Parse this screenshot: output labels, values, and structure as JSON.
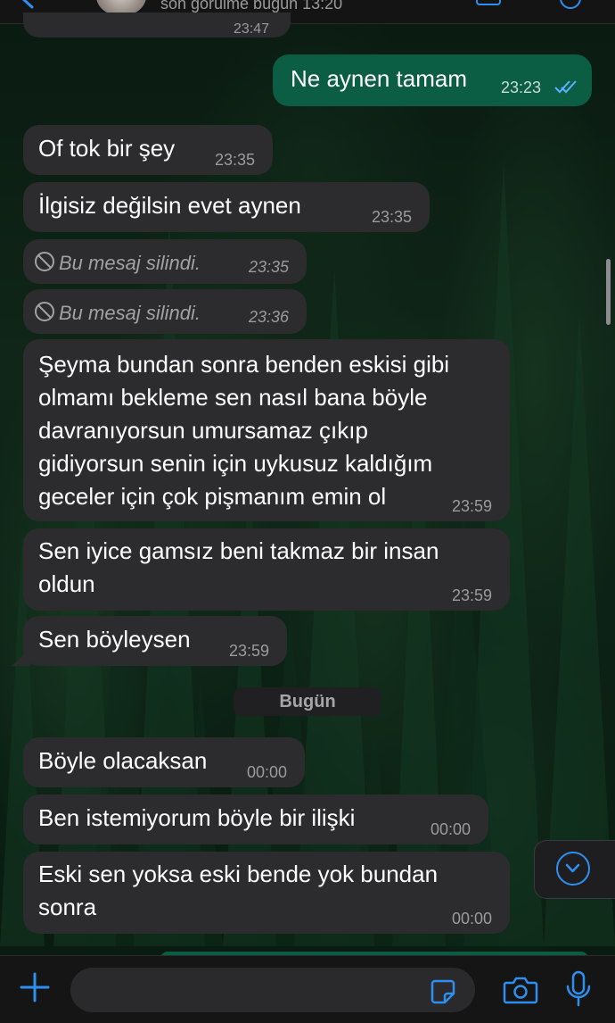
{
  "header": {
    "last_seen": "son görülme bugün 13:20",
    "prev_time": "23:47"
  },
  "outgoing": {
    "text": "Ne aynen tamam",
    "time": "23:23",
    "status": "read-double-check-icon"
  },
  "messages": [
    {
      "text": "Of tok bir şey",
      "time": "23:35"
    },
    {
      "text": "İlgisiz değilsin evet aynen",
      "time": "23:35"
    },
    {
      "text": "Bu mesaj silindi.",
      "time": "23:35",
      "deleted": true
    },
    {
      "text": "Bu mesaj silindi.",
      "time": "23:36",
      "deleted": true
    },
    {
      "text": "Şeyma bundan sonra benden eskisi gibi olmamı bekleme sen nasıl bana böyle davranıyorsun umursamaz çıkıp gidiyorsun senin için uykusuz kaldığım geceler için çok pişmanım emin ol",
      "time": "23:59"
    },
    {
      "text": "Sen iyice gamsız beni takmaz bir insan oldun",
      "time": "23:59"
    },
    {
      "text": "Sen böyleysen",
      "time": "23:59"
    },
    {
      "text": "Böyle olacaksan",
      "time": "00:00"
    },
    {
      "text": "Ben istemiyorum böyle bir ilişki",
      "time": "00:00"
    },
    {
      "text": "Eski sen yoksa eski bende yok bundan sonra",
      "time": "00:00"
    }
  ],
  "date_separator": "Bugün",
  "input": {
    "placeholder": ""
  },
  "colors": {
    "incoming_bubble": "#2c2c2e",
    "outgoing_bubble": "#0b5e44",
    "accent": "#2f8ff0"
  }
}
